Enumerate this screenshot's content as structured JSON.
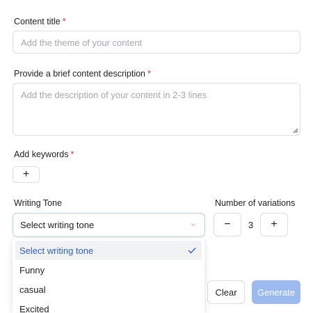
{
  "form": {
    "title_label": "Content title",
    "title_placeholder": "Add the theme of your content",
    "desc_label": "Provide a brief content description",
    "desc_placeholder": "Add the description of your content in 2-3 lines",
    "keywords_label": "Add keywords",
    "add_keyword_symbol": "+",
    "required_mark": "*",
    "tone_label": "Writing Tone",
    "tone_selected": "Select writing tone",
    "variations_label": "Number of variations",
    "variations_value": "3",
    "minus_symbol": "−",
    "plus_symbol": "+"
  },
  "dropdown": {
    "options": [
      "Select writing tone",
      "Funny",
      "casual",
      "Excited"
    ]
  },
  "actions": {
    "clear_label": "Clear",
    "generate_label": "Generate"
  },
  "colors": {
    "accent": "#2a5fd0",
    "generate_bg": "#9bbaf0",
    "required": "#c0392b"
  },
  "icons": {
    "tone_select": "chevron-down-icon",
    "selected_option": "check-icon",
    "textarea_resize": "resize-grip-icon"
  }
}
